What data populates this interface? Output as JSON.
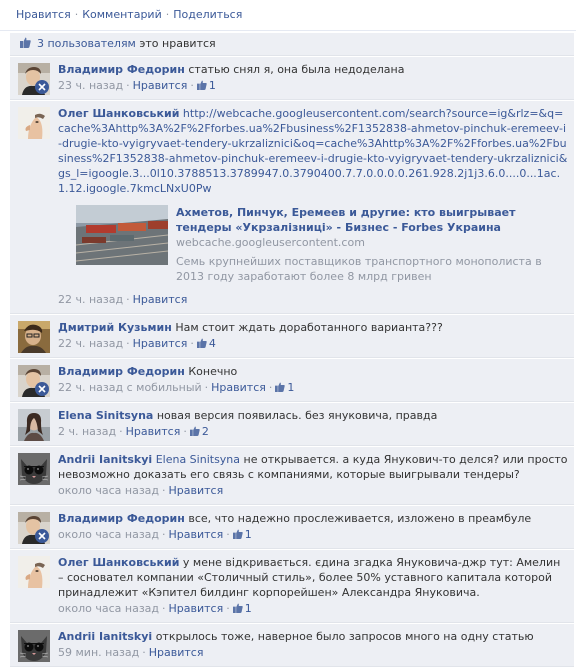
{
  "actions": {
    "like": "Нравится",
    "comment": "Комментарий",
    "share": "Поделиться"
  },
  "likes_summary": {
    "prefix": "3 пользователям",
    "suffix": "это нравится"
  },
  "comments": [
    {
      "author": "Владимир Федорин",
      "text": "статью снял я, она была недоделана",
      "time": "23 ч. назад",
      "like": "Нравится",
      "likes": "1",
      "avatar": "vladimir"
    },
    {
      "author": "Олег Шанковський",
      "text": "",
      "link": "http://webcache.googleusercontent.com/search?source=ig&rlz=&q=cache%3Ahttp%3A%2F%2Fforbes.ua%2Fbusiness%2F1352838-ahmetov-pinchuk-eremeev-i-drugie-kto-vyigryvaet-tendery-ukrzaliznici&oq=cache%3Ahttp%3A%2F%2Fforbes.ua%2Fbusiness%2F1352838-ahmetov-pinchuk-eremeev-i-drugie-kto-vyigryvaet-tendery-ukrzaliznici&gs_l=igoogle.3...0l10.3788513.3789947.0.3790400.7.7.0.0.0.0.261.928.2j1j3.6.0....0...1ac.1.12.igoogle.7kmcLNxU0Pw",
      "time": "22 ч. назад",
      "like": "Нравится",
      "likes": "",
      "avatar": "oleg",
      "preview": {
        "title": "Ахметов, Пинчук, Еремеев и другие: кто выигрывает тендеры «Укрзалізниці» - Бизнес - Forbes Украина",
        "domain": "webcache.googleusercontent.com",
        "desc": "Семь крупнейших поставщиков транспортного монополиста в 2013 году заработают более 8 млрд гривен"
      }
    },
    {
      "author": "Дмитрий Кузьмин",
      "text": "Нам стоит ждать доработанного варианта???",
      "time": "22 ч. назад",
      "like": "Нравится",
      "likes": "4",
      "avatar": "dmitry"
    },
    {
      "author": "Владимир Федорин",
      "text": "Конечно",
      "time": "22 ч. назад с мобильный",
      "like": "Нравится",
      "likes": "1",
      "avatar": "vladimir"
    },
    {
      "author": "Elena Sinitsyna",
      "text": "новая версия появилась. без януковича, правда",
      "time": "2 ч. назад",
      "like": "Нравится",
      "likes": "2",
      "avatar": "elena"
    },
    {
      "author": "Andrii Ianitskyi",
      "mention": "Elena Sinitsyna",
      "text": "не открывается. а куда Янукович-то делся? или просто невозможно доказать его связь с компаниями, которые выигрывали тендеры?",
      "time": "около часа назад",
      "like": "Нравится",
      "likes": "",
      "avatar": "andrii"
    },
    {
      "author": "Владимир Федорин",
      "text": "все, что надежно прослеживается, изложено в преамбуле",
      "time": "около часа назад",
      "like": "Нравится",
      "likes": "1",
      "avatar": "vladimir"
    },
    {
      "author": "Олег Шанковський",
      "text": "у мене відкривається. єдина згадка Януковича-джр тут: Амелин – сосновател компании «Столичный стиль», более 50% уставного капитала которой принадлежит «Кэпител билдинг корпорейшен» Александра Януковича.",
      "time": "около часа назад",
      "like": "Нравится",
      "likes": "1",
      "avatar": "oleg"
    },
    {
      "author": "Andrii Ianitskyi",
      "text": "открылось тоже, наверное было запросов много на одну статью",
      "time": "59 мин. назад",
      "like": "Нравится",
      "likes": "",
      "avatar": "andrii"
    }
  ],
  "colors": {
    "link": "#3b5998",
    "background": "#edeff4",
    "muted": "#9197a3"
  }
}
